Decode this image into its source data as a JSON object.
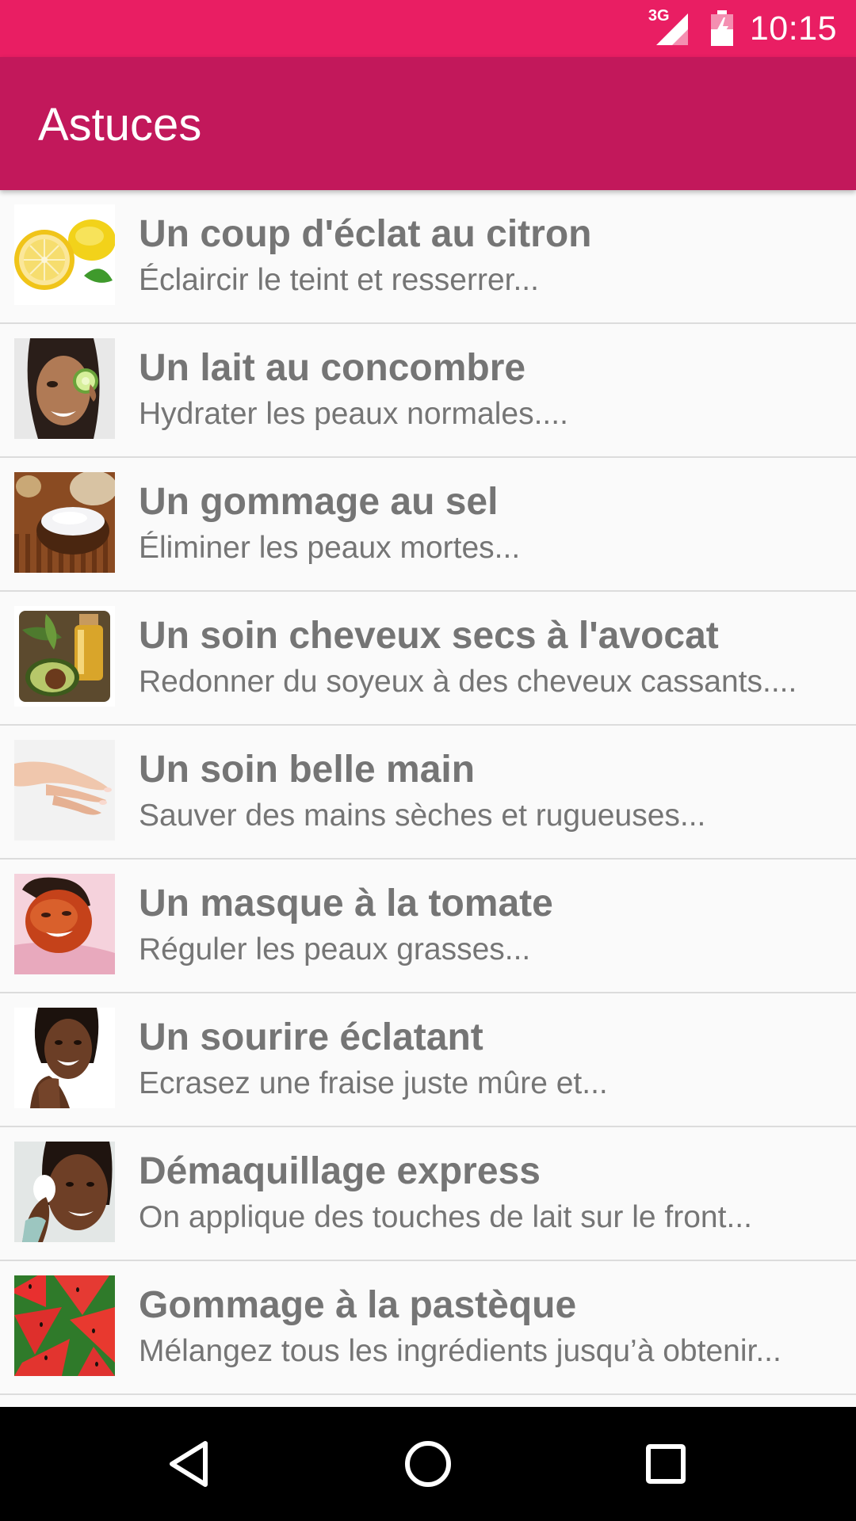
{
  "status_bar": {
    "network": "3G",
    "time": "10:15",
    "color": "#e91e63"
  },
  "app_bar": {
    "title": "Astuces",
    "color": "#c2185b"
  },
  "tips": [
    {
      "title": "Un coup d'éclat au citron",
      "subtitle": "Éclaircir le teint et resserrer...",
      "icon": "lemon-thumbnail"
    },
    {
      "title": "Un lait au concombre",
      "subtitle": "Hydrater les peaux normales....",
      "icon": "cucumber-face-thumbnail"
    },
    {
      "title": "Un gommage au sel",
      "subtitle": "Éliminer les peaux mortes...",
      "icon": "salt-bowl-thumbnail"
    },
    {
      "title": "Un soin cheveux secs à l'avocat",
      "subtitle": "Redonner du soyeux à des cheveux cassants....",
      "icon": "avocado-oil-thumbnail"
    },
    {
      "title": "Un soin belle main",
      "subtitle": "Sauver des mains sèches et rugueuses...",
      "icon": "hand-thumbnail"
    },
    {
      "title": "Un masque à la tomate",
      "subtitle": "Réguler les peaux grasses...",
      "icon": "tomato-mask-thumbnail"
    },
    {
      "title": "Un sourire éclatant",
      "subtitle": "Ecrasez une fraise juste mûre et...",
      "icon": "smile-thumbnail"
    },
    {
      "title": "Démaquillage express",
      "subtitle": "On applique des touches de lait sur le front...",
      "icon": "makeup-removal-thumbnail"
    },
    {
      "title": "Gommage à la pastèque",
      "subtitle": "Mélangez tous les ingrédients jusqu’à obtenir...",
      "icon": "watermelon-thumbnail"
    }
  ],
  "nav_bar": {
    "back_icon": "back-triangle-icon",
    "home_icon": "home-circle-icon",
    "recents_icon": "recents-square-icon"
  }
}
